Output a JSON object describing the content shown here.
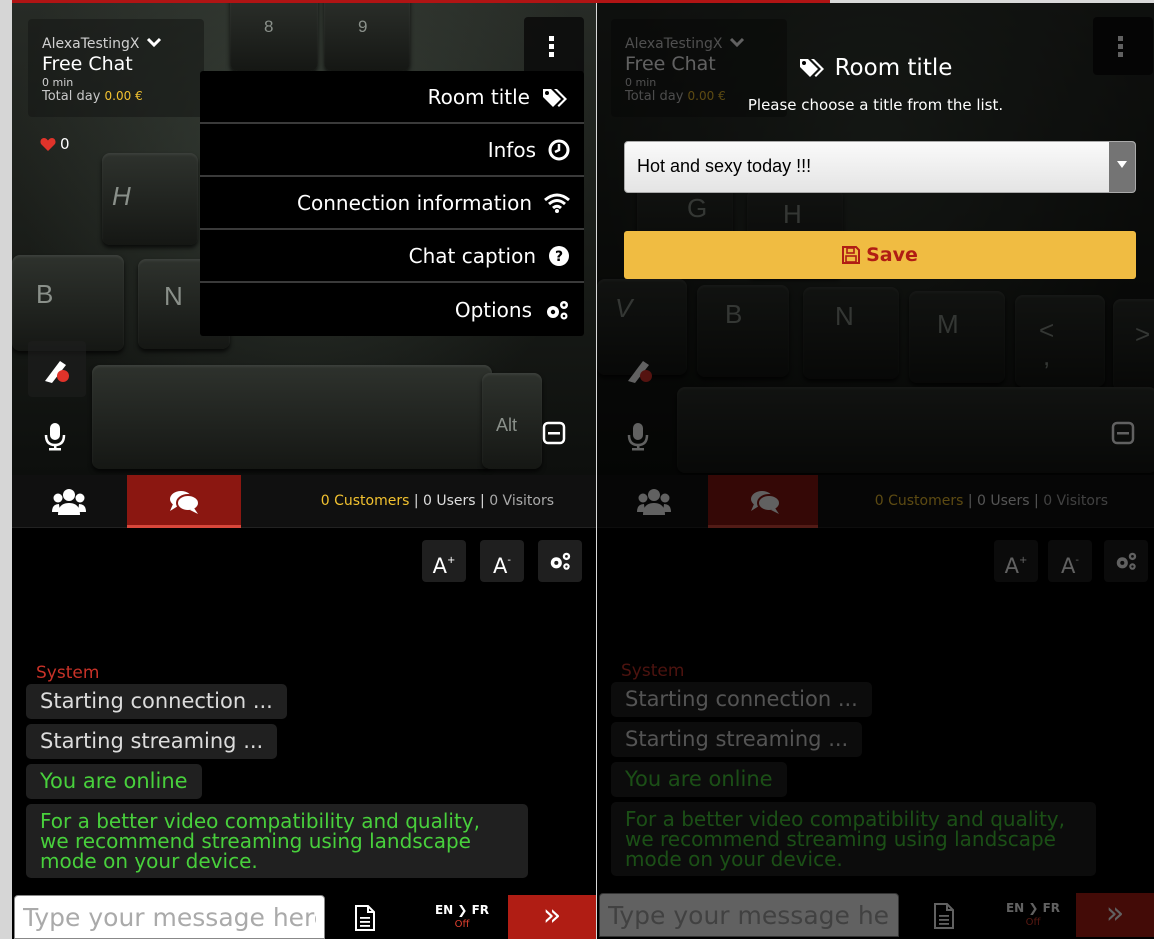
{
  "left": {
    "username": "AlexaTestingX",
    "chat_type": "Free Chat",
    "minutes": "0 min",
    "total_label": "Total day",
    "total_amount": "0.00 €",
    "likes": "0",
    "menu": [
      {
        "label": "Room title",
        "icon": "tags-icon"
      },
      {
        "label": "Infos",
        "icon": "clock-icon"
      },
      {
        "label": "Connection information",
        "icon": "wifi-icon"
      },
      {
        "label": "Chat caption",
        "icon": "question-circle-icon"
      },
      {
        "label": "Options",
        "icon": "cogs-icon"
      }
    ],
    "keys": [
      "8",
      "9",
      "H",
      "B",
      "N",
      "Alt"
    ]
  },
  "counts": {
    "customers": "0 Customers",
    "users": "0 Users",
    "visitors": "0 Visitors",
    "sep": "|"
  },
  "tools": {
    "font_up": "A",
    "font_up_sup": "+",
    "font_down": "A",
    "font_down_sup": "-"
  },
  "chat": {
    "system_label": "System",
    "messages": [
      {
        "text": "Starting connection ...",
        "color": "#dcdcdc"
      },
      {
        "text": "Starting streaming ...",
        "color": "#dcdcdc"
      },
      {
        "text": "You are online",
        "color": "#48d03c"
      }
    ],
    "recommend_lines": [
      "For a better video compatibility and quality,",
      "we recommend streaming using landscape",
      "mode on your device."
    ]
  },
  "input": {
    "placeholder": "Type your message here",
    "translate": "EN ❯ FR",
    "translate_status": "Off",
    "send": "»"
  },
  "dialog": {
    "title": "Room title",
    "subtitle": "Please choose a title from the list.",
    "selected": "Hot and sexy today !!!",
    "save": "Save"
  },
  "right_keys": [
    "G",
    "H",
    "V",
    "B",
    "N",
    "M",
    "<",
    ">",
    ","
  ],
  "colors": {
    "accent_red": "#b01d14",
    "gold": "#f0bc42",
    "online_green": "#48d03c"
  }
}
